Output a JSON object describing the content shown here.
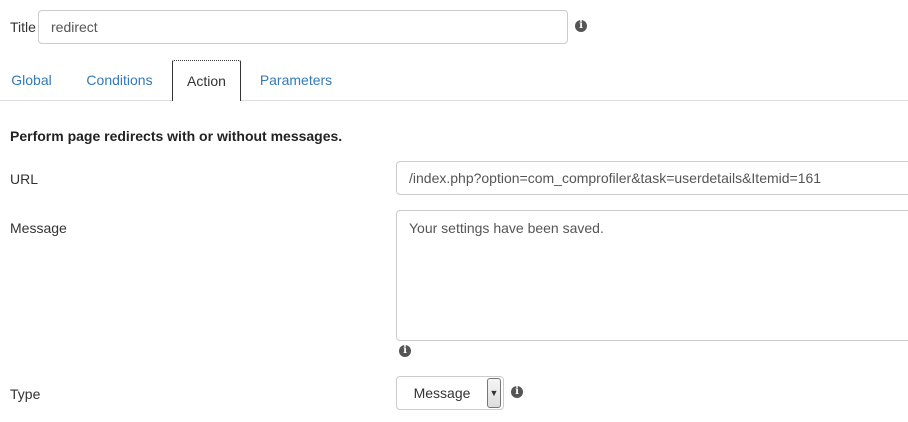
{
  "title_field": {
    "label": "Title",
    "value": "redirect"
  },
  "tabs": [
    {
      "label": "Global"
    },
    {
      "label": "Conditions"
    },
    {
      "label": "Action"
    },
    {
      "label": "Parameters"
    }
  ],
  "active_tab": "Action",
  "section": {
    "heading": "Perform page redirects with or without messages."
  },
  "url_field": {
    "label": "URL",
    "value": "/index.php?option=com_comprofiler&task=userdetails&Itemid=161"
  },
  "message_field": {
    "label": "Message",
    "value": "Your settings have been saved."
  },
  "type_field": {
    "label": "Type",
    "selected": "Message"
  },
  "icons": {
    "info": "info-icon",
    "dropdown": "chevron-down-icon"
  }
}
